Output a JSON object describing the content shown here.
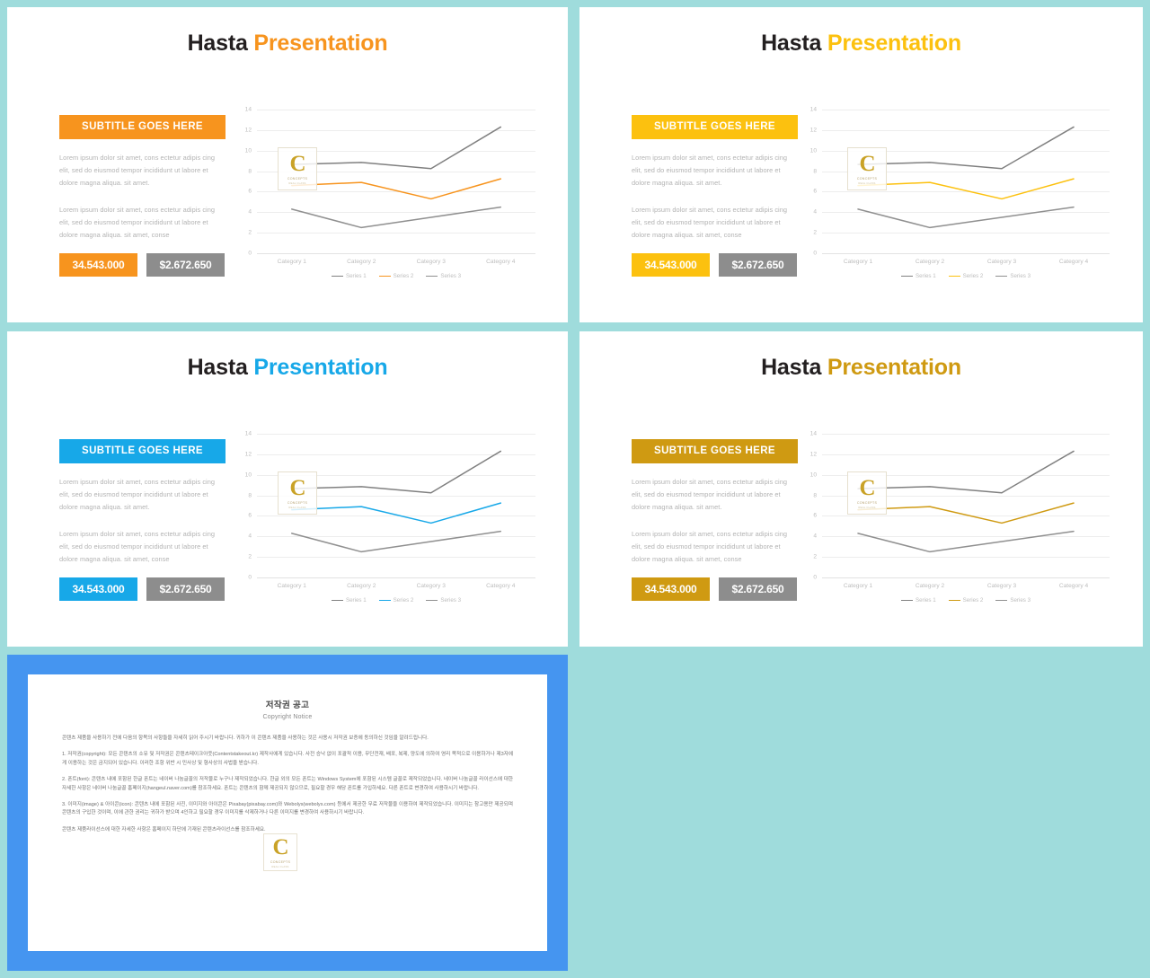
{
  "theme": {
    "page_background": "#9fdcdc",
    "gutter": "#9fdcdc",
    "slide_background": "#ffffff",
    "grey_accent": "#8d8d8d",
    "body_text": "#b3b3b3",
    "axis_text": "#bdbdbd",
    "gridline": "#ededed",
    "copyright_panel_border": "#4595f0",
    "logo_gold": "#c9a227"
  },
  "logo": {
    "letter": "C",
    "name": "CONCEPTS",
    "tagline": "REAL  CLASS",
    "icon": "logo-watermark-icon"
  },
  "slides": [
    {
      "id": "slide-1",
      "accent": "#f7941e",
      "accent_name": "orange",
      "title_first": "Hasta",
      "title_second": "Presentation",
      "subtitle": "SUBTITLE GOES HERE",
      "paragraph_1": "Lorem ipsum dolor sit amet, cons ectetur adipis cing elit, sed do eiusmod tempor incididunt ut labore et dolore magna aliqua. sit amet.",
      "paragraph_2": "Lorem ipsum dolor sit amet, cons ectetur adipis cing elit, sed do eiusmod tempor incididunt ut labore et dolore magna aliqua. sit amet, conse",
      "stat_primary": "34.543.000",
      "stat_secondary": "$2.672.650"
    },
    {
      "id": "slide-2",
      "accent": "#fcc10f",
      "accent_name": "yellow",
      "title_first": "Hasta",
      "title_second": "Presentation",
      "subtitle": "SUBTITLE GOES HERE",
      "paragraph_1": "Lorem ipsum dolor sit amet, cons ectetur adipis cing elit, sed do eiusmod tempor incididunt ut labore et dolore magna aliqua. sit amet.",
      "paragraph_2": "Lorem ipsum dolor sit amet, cons ectetur adipis cing elit, sed do eiusmod tempor incididunt ut labore et dolore magna aliqua. sit amet, conse",
      "stat_primary": "34.543.000",
      "stat_secondary": "$2.672.650"
    },
    {
      "id": "slide-3",
      "accent": "#17a8e8",
      "accent_name": "blue",
      "title_first": "Hasta",
      "title_second": "Presentation",
      "subtitle": "SUBTITLE GOES HERE",
      "paragraph_1": "Lorem ipsum dolor sit amet, cons ectetur adipis cing elit, sed do eiusmod tempor incididunt ut labore et dolore magna aliqua. sit amet.",
      "paragraph_2": "Lorem ipsum dolor sit amet, cons ectetur adipis cing elit, sed do eiusmod tempor incididunt ut labore et dolore magna aliqua. sit amet, conse",
      "stat_primary": "34.543.000",
      "stat_secondary": "$2.672.650"
    },
    {
      "id": "slide-4",
      "accent": "#cf9a12",
      "accent_name": "dark-gold",
      "title_first": "Hasta",
      "title_second": "Presentation",
      "subtitle": "SUBTITLE GOES HERE",
      "paragraph_1": "Lorem ipsum dolor sit amet, cons ectetur adipis cing elit, sed do eiusmod tempor incididunt ut labore et dolore magna aliqua. sit amet.",
      "paragraph_2": "Lorem ipsum dolor sit amet, cons ectetur adipis cing elit, sed do eiusmod tempor incididunt ut labore et dolore magna aliqua. sit amet, conse",
      "stat_primary": "34.543.000",
      "stat_secondary": "$2.672.650"
    }
  ],
  "chart_data": {
    "type": "line",
    "title": "",
    "xlabel": "",
    "ylabel": "",
    "categories": [
      "Category 1",
      "Category 2",
      "Category 3",
      "Category 4"
    ],
    "ylim": [
      0,
      14
    ],
    "yticks": [
      0,
      2,
      4,
      6,
      8,
      10,
      12,
      14
    ],
    "grid": true,
    "legend_position": "bottom",
    "series": [
      {
        "name": "Series 1",
        "values": [
          8.65,
          8.85,
          8.25,
          12.3
        ],
        "color": "#808080"
      },
      {
        "name": "Series 2",
        "values": [
          6.6,
          6.9,
          5.3,
          7.25
        ],
        "color": "accent"
      },
      {
        "name": "Series 3",
        "values": [
          4.3,
          2.5,
          3.5,
          4.5
        ],
        "color": "#909090"
      }
    ]
  },
  "copyright": {
    "title_kr": "저작권 공고",
    "title_en": "Copyright Notice",
    "paragraphs": [
      "콘텐츠 제품을 사용하기 전에 다음의 항목의 사항들을 자세히 읽어 주시기 바랍니다. 귀하가 이 콘텐츠 제품을 사용하는 것은 사용시 저작권 보증에 동의하신 것임을 알려드립니다.",
      "1. 저작권(copyright): 모든 콘텐츠의 소유 및 저작권은 콘텐츠테이크아웃(Contentstakeout.kr) 제작사에게 있습니다. 사전 승낙 없이 포괄적 이용, 무단전재, 배포, 복제, 양도에 의하여 영리 목적으로 이용하거나 제3자에게 이용하는 것은 금지되어 있습니다. 이러한 조항 위반 시 민사상 및 형사상의 사법을 받습니다.",
      "2. 폰트(font): 콘텐츠 내에 포함된 한글 폰트는 네이버 나눔글꼴의 저작물로 누구나 제작되었습니다. 한글 외의 모든 폰트는 Windows System에 포함된 시스템 글꼴로 제작되었습니다. 네이버 나눔글꼴 라이선스에 대한 자세한 사항은 네이버 나눔글꼴 홈페이지(hangeul.naver.com)를 참조하세요. 폰트는 콘텐츠의 함께 제공되지 않으므로, 필요할 경우 해당 폰트를 가입하세요. 다른 폰트로 변경하여 사용하시기 바랍니다.",
      "3. 이미지(image) & 아이콘(icon): 콘텐츠 내에 포함된 사진, 이미지와 아이콘은 Pixabay(pixabay.com)와 Webolys(webolys.com) 등에서 제공한 무료 저작물을 이용하여 제작되었습니다. 이미지는 참고용만 제공되며 콘텐츠의 구입한 것이며, 이에 관한 권리는 귀하가 받으며 4인하고 필요할 경우 이미지를 삭제하거나 다른 이미지를 변경하여 사용하시기 바랍니다.",
      "콘텐츠 제품라이선스에 대한 자세한 사항은 홈페이지 하단에 기재된 콘텐츠라이선스를 참조하세요."
    ]
  }
}
